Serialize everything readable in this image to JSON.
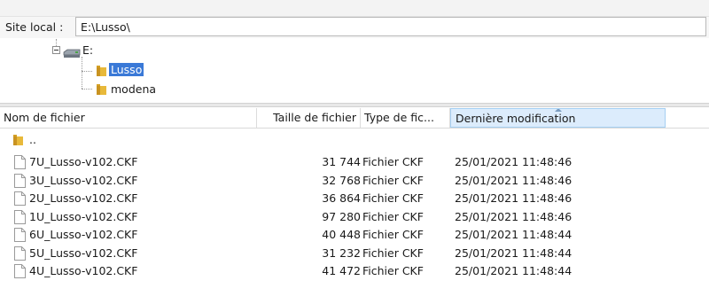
{
  "site": {
    "label": "Site local :",
    "path": "E:\\Lusso\\"
  },
  "tree": {
    "drive": "E:",
    "folders": [
      "Lusso",
      "modena"
    ],
    "selected": "Lusso"
  },
  "columns": [
    "Nom de fichier",
    "Taille de fichier",
    "Type de fic...",
    "Dernière modification"
  ],
  "parent_row": {
    "name": ".."
  },
  "files": [
    {
      "name": "7U_Lusso-v102.CKF",
      "size": "31 744",
      "type": "Fichier CKF",
      "modified": "25/01/2021 11:48:46"
    },
    {
      "name": "3U_Lusso-v102.CKF",
      "size": "32 768",
      "type": "Fichier CKF",
      "modified": "25/01/2021 11:48:46"
    },
    {
      "name": "2U_Lusso-v102.CKF",
      "size": "36 864",
      "type": "Fichier CKF",
      "modified": "25/01/2021 11:48:46"
    },
    {
      "name": "1U_Lusso-v102.CKF",
      "size": "97 280",
      "type": "Fichier CKF",
      "modified": "25/01/2021 11:48:46"
    },
    {
      "name": "6U_Lusso-v102.CKF",
      "size": "40 448",
      "type": "Fichier CKF",
      "modified": "25/01/2021 11:48:44"
    },
    {
      "name": "5U_Lusso-v102.CKF",
      "size": "31 232",
      "type": "Fichier CKF",
      "modified": "25/01/2021 11:48:44"
    },
    {
      "name": "4U_Lusso-v102.CKF",
      "size": "41 472",
      "type": "Fichier CKF",
      "modified": "25/01/2021 11:48:44"
    }
  ],
  "colors": {
    "selection": "#3a79d7",
    "header_active": "#dcecfc",
    "folder": "#e8b93a"
  }
}
